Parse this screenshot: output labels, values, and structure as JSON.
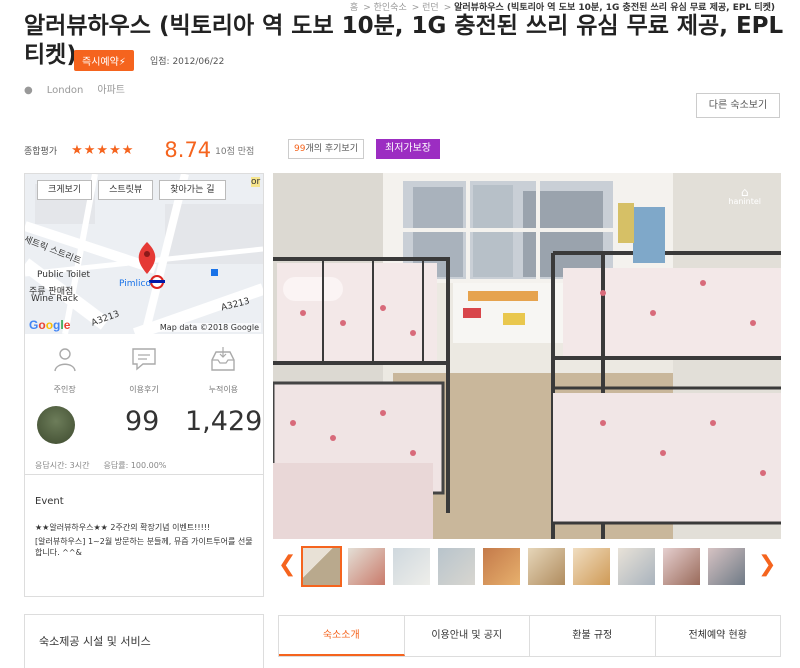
{
  "breadcrumb": [
    "홈",
    "한인숙소",
    "런던",
    "알러뷰하우스 (빅토리아 역 도보 10분, 1G 충전된 쓰리 유심 무료 제공, EPL 티켓)"
  ],
  "title": "알러뷰하우스 (빅토리아 역 도보 10분, 1G 충전된 쓰리 유심 무료 제공, EPL 티켓)",
  "badge": "즉시예약⚡",
  "entry_date": "입점: 2012/06/22",
  "location": {
    "city": "London",
    "type": "아파트"
  },
  "other_lodging_button": "다른 숙소보기",
  "rating": {
    "label": "종합평가",
    "stars": 4.5,
    "score": "8.74",
    "max": "10점 만점",
    "review_count": "99",
    "review_suffix": "개의 후기보기",
    "best_price": "최저가보장"
  },
  "map": {
    "buttons": [
      "크게보기",
      "스트릿뷰",
      "찾아가는 길"
    ],
    "labels": [
      "세트릭 스트리트",
      "Public Toilet",
      "Pimlico",
      "주류 판매점",
      "Wine Rack",
      "A3213",
      "A3213",
      "or"
    ],
    "google": "Google",
    "data": "Map data ©2018 Google"
  },
  "host": {
    "labels": [
      "주인장",
      "이용후기",
      "누적이용"
    ],
    "reviews": "99",
    "uses": "1,429",
    "response_time": "응답시간: 3시간",
    "response_rate": "응답률: 100.00%"
  },
  "event": {
    "title": "Event",
    "line1": "★★알러뷰하우스★★ 2주간의 확장기념 이벤트!!!!!",
    "line2": "[알러뷰하우스] 1~2월 방문하는 분들께, 뮤즘 가이트투어를 선물합니다. ^^&"
  },
  "photo_logo": "hanintel",
  "facilities_title": "숙소제공 시설 및 서비스",
  "tabs": [
    "숙소소개",
    "이용안내 및 공지",
    "환불 규정",
    "전체예약 현황"
  ],
  "colors": {
    "accent": "#f5641e",
    "purple": "#9c2dc2"
  }
}
